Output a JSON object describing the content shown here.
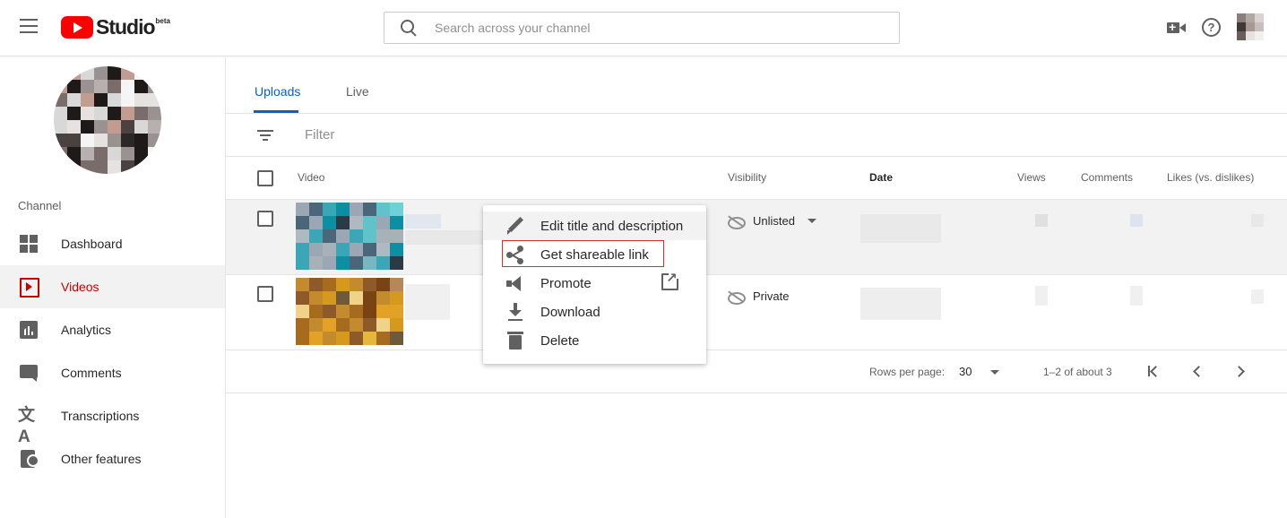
{
  "header": {
    "logo_text": "Studio",
    "logo_badge": "beta",
    "search_placeholder": "Search across your channel",
    "icons": [
      "menu-icon",
      "search-icon",
      "create-video-icon",
      "help-icon",
      "account-avatar"
    ]
  },
  "sidebar": {
    "section_label": "Channel",
    "items": [
      {
        "label": "Dashboard",
        "icon": "dashboard-icon"
      },
      {
        "label": "Videos",
        "icon": "videos-icon",
        "active": true
      },
      {
        "label": "Analytics",
        "icon": "analytics-icon"
      },
      {
        "label": "Comments",
        "icon": "comments-icon"
      },
      {
        "label": "Transcriptions",
        "icon": "translate-icon"
      },
      {
        "label": "Other features",
        "icon": "other-features-icon"
      }
    ]
  },
  "main": {
    "tabs": [
      {
        "label": "Uploads",
        "active": true
      },
      {
        "label": "Live"
      }
    ],
    "filter_placeholder": "Filter",
    "columns": [
      "Video",
      "Visibility",
      "Date",
      "Views",
      "Comments",
      "Likes (vs. dislikes)"
    ],
    "rows": [
      {
        "visibility": "Unlisted"
      },
      {
        "visibility": "Private"
      }
    ],
    "footer": {
      "rows_per_page_label": "Rows per page:",
      "rows_per_page_value": "30",
      "range_text": "1–2 of about 3"
    }
  },
  "context_menu": {
    "items": [
      {
        "label": "Edit title and description",
        "icon": "pencil-icon"
      },
      {
        "label": "Get shareable link",
        "icon": "share-icon",
        "outlined": true
      },
      {
        "label": "Promote",
        "icon": "megaphone-icon"
      },
      {
        "label": "Download",
        "icon": "download-icon"
      },
      {
        "label": "Delete",
        "icon": "trash-icon"
      }
    ]
  },
  "colors": {
    "accent_blue": "#065fd4",
    "active_red": "#cc0000",
    "brand_red": "#ff0000",
    "highlight_outline": "#d93025"
  }
}
